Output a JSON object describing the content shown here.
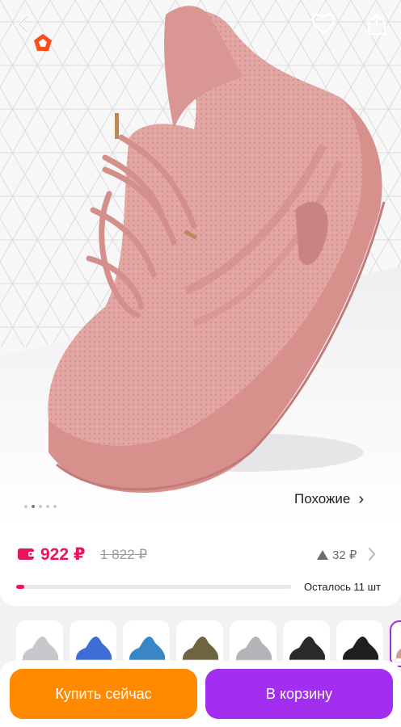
{
  "hero": {
    "icons": {
      "back": "chevron-left-icon",
      "brand": "pentagon-logo-icon",
      "favorite": "heart-icon",
      "share": "share-icon"
    },
    "image_count": 5,
    "active_image": 1,
    "similar_label": "Похожие",
    "similar_chevron": "›"
  },
  "price_block": {
    "price": "922 ₽",
    "old_price": "1 822 ₽",
    "rating_value": "32 ₽",
    "stock_label": "Осталось 11 шт",
    "stock_fraction": 0.03,
    "colors": {
      "price": "#e8155e",
      "muted": "#9a9aa0"
    }
  },
  "variants": {
    "selected_index": 7,
    "items": [
      {
        "name": "variant-light-gray",
        "color": "#c7c8cb"
      },
      {
        "name": "variant-blue",
        "color": "#3d6ed8"
      },
      {
        "name": "variant-steel-blue",
        "color": "#3a86c4"
      },
      {
        "name": "variant-olive",
        "color": "#6e6440"
      },
      {
        "name": "variant-gray",
        "color": "#b3b4b8"
      },
      {
        "name": "variant-black",
        "color": "#2a2a2c"
      },
      {
        "name": "variant-black-2",
        "color": "#1f1f21"
      },
      {
        "name": "variant-pink",
        "color": "#d59a95"
      }
    ]
  },
  "actions": {
    "buy_now": "Купить сейчас",
    "add_to_cart": "В корзину",
    "colors": {
      "buy": "#ff8a00",
      "cart": "#a42ef0"
    }
  }
}
